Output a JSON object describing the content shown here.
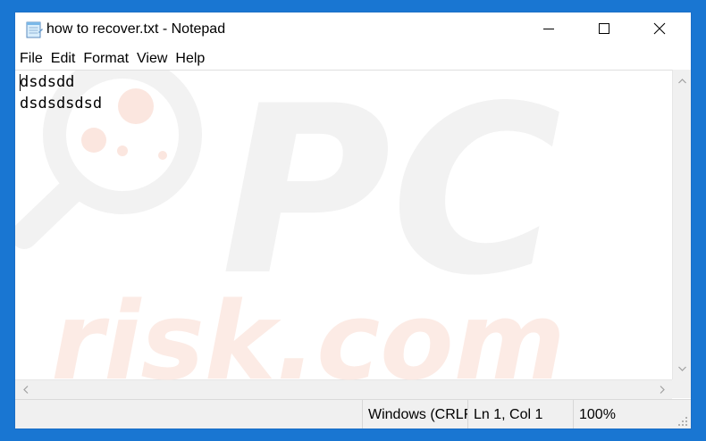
{
  "window": {
    "title": "how to recover.txt - Notepad",
    "app_icon": "notepad-icon"
  },
  "title_controls": {
    "minimize_icon": "minimize-icon",
    "maximize_icon": "maximize-icon",
    "close_icon": "close-icon"
  },
  "menu": {
    "items": [
      {
        "label": "File"
      },
      {
        "label": "Edit"
      },
      {
        "label": "Format"
      },
      {
        "label": "View"
      },
      {
        "label": "Help"
      }
    ]
  },
  "editor": {
    "lines": [
      "dsdsdd",
      "dsdsdsdsd"
    ]
  },
  "watermark": {
    "line1": "PC",
    "line2": "risk.com"
  },
  "status": {
    "line_ending": "Windows (CRLF)",
    "position": "Ln 1, Col 1",
    "zoom": "100%"
  },
  "colors": {
    "desktop": "#1976d2",
    "window_bg": "#ffffff",
    "chrome_bg": "#f0f0f0",
    "watermark": "#f1f1f1",
    "watermark_accent": "#fbe3dc"
  }
}
